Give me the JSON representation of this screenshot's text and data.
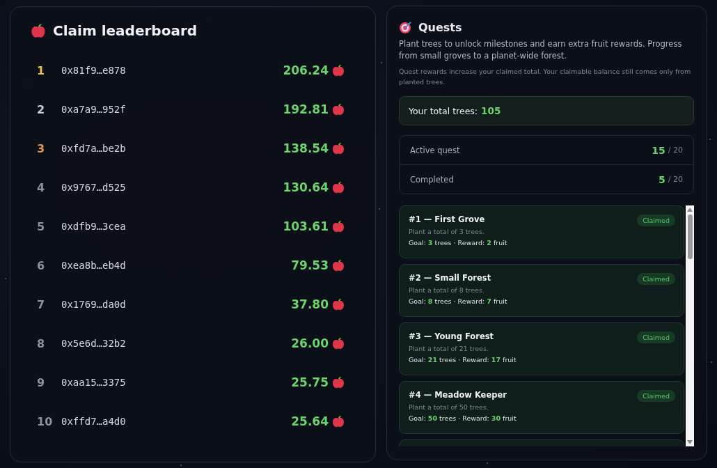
{
  "leaderboard": {
    "title": "Claim leaderboard",
    "rows": [
      {
        "rank": "1",
        "color": "#e8c24a",
        "address": "0x81f9…e878",
        "amount": "206.24"
      },
      {
        "rank": "2",
        "color": "#c9ccd4",
        "address": "0xa7a9…952f",
        "amount": "192.81"
      },
      {
        "rank": "3",
        "color": "#e0954a",
        "address": "0xfd7a…be2b",
        "amount": "138.54"
      },
      {
        "rank": "4",
        "color": "#8d929c",
        "address": "0x9767…d525",
        "amount": "130.64"
      },
      {
        "rank": "5",
        "color": "#8d929c",
        "address": "0xdfb9…3cea",
        "amount": "103.61"
      },
      {
        "rank": "6",
        "color": "#8d929c",
        "address": "0xea8b…eb4d",
        "amount": "79.53"
      },
      {
        "rank": "7",
        "color": "#8d929c",
        "address": "0x1769…da0d",
        "amount": "37.80"
      },
      {
        "rank": "8",
        "color": "#8d929c",
        "address": "0x5e6d…32b2",
        "amount": "26.00"
      },
      {
        "rank": "9",
        "color": "#8d929c",
        "address": "0xaa15…3375",
        "amount": "25.75"
      },
      {
        "rank": "10",
        "color": "#8d929c",
        "address": "0xffd7…a4d0",
        "amount": "25.64"
      }
    ]
  },
  "quests": {
    "title": "Quests",
    "description": "Plant trees to unlock milestones and earn extra fruit rewards. Progress from small groves to a planet-wide forest.",
    "note": "Quest rewards increase your claimed total. Your claimable balance still comes only from planted trees.",
    "total_label": "Your total trees:",
    "total_value": "105",
    "stats": [
      {
        "label": "Active quest",
        "value": "15",
        "total": "/ 20"
      },
      {
        "label": "Completed",
        "value": "5",
        "total": "/ 20"
      }
    ],
    "items": [
      {
        "title": "#1 — First Grove",
        "description": "Plant a total of 3 trees.",
        "goal": "Goal: **3** trees · Reward: **2** fruit",
        "status": "Claimed",
        "claimed": true
      },
      {
        "title": "#2 — Small Forest",
        "description": "Plant a total of 8 trees.",
        "goal": "Goal: **8** trees · Reward: **7** fruit",
        "status": "Claimed",
        "claimed": true
      },
      {
        "title": "#3 — Young Forest",
        "description": "Plant a total of 21 trees.",
        "goal": "Goal: **21** trees · Reward: **17** fruit",
        "status": "Claimed",
        "claimed": true
      },
      {
        "title": "#4 — Meadow Keeper",
        "description": "Plant a total of 50 trees.",
        "goal": "Goal: **50** trees · Reward: **30** fruit",
        "status": "Claimed",
        "claimed": true
      }
    ]
  }
}
